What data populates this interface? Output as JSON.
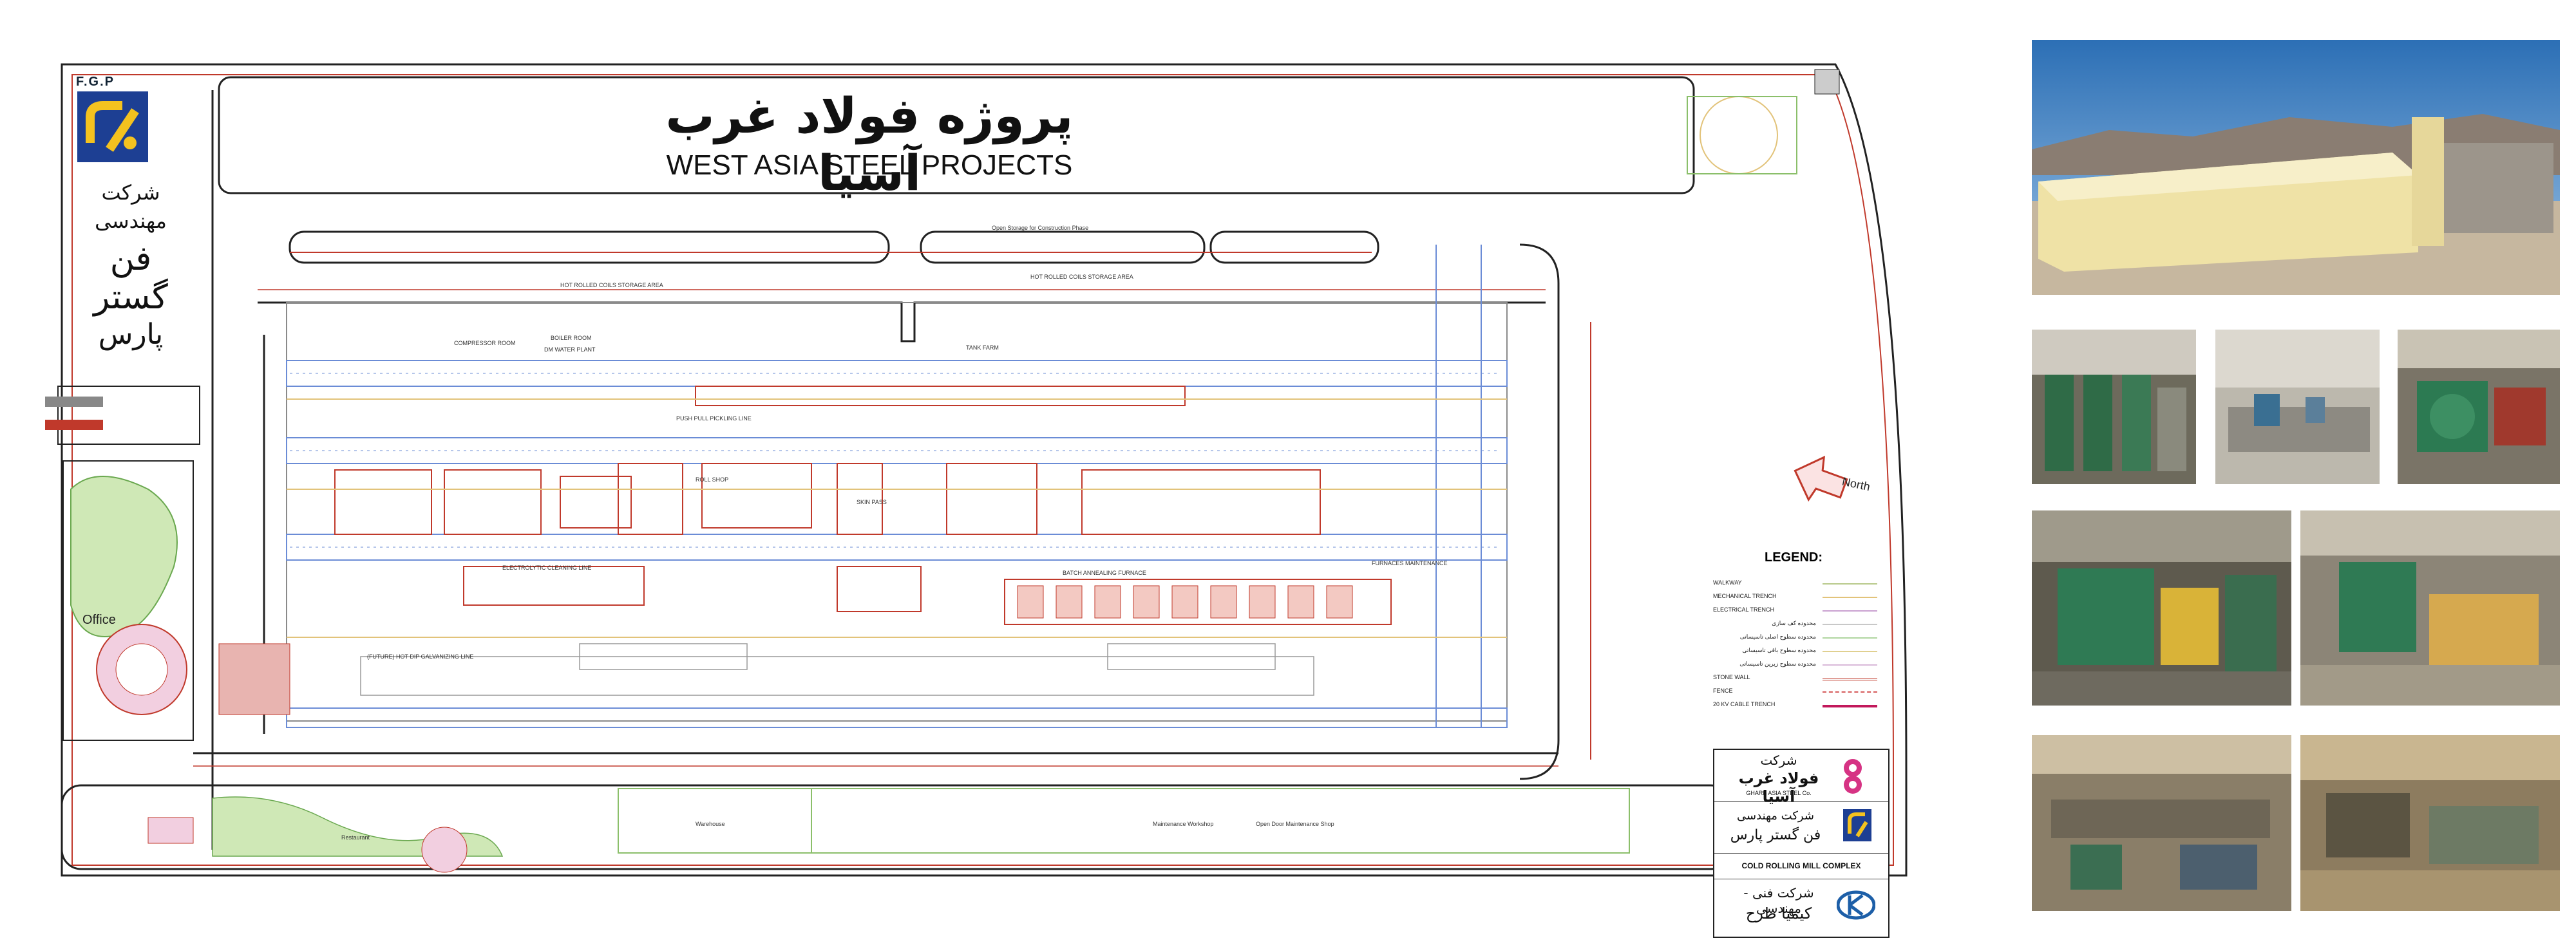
{
  "header": {
    "title_fa": "پروژه فولاد غرب آسیا",
    "title_en": "WEST ASIA STEEL PROJECTS"
  },
  "logo": {
    "abbr": "F.G.P",
    "company_line1": "شرکت",
    "company_line2": "مهندسی",
    "company_line3": "فن گستر",
    "company_line4": "پارس",
    "colors": {
      "brand_blue": "#1d3f93",
      "brand_yellow": "#f4c21f"
    }
  },
  "plan_labels": {
    "open_storage": "Open Storage for Construction Phase",
    "hot_rolled_1": "HOT ROLLED COILS STORAGE AREA",
    "hot_rolled_2": "HOT ROLLED COILS STORAGE AREA",
    "tank_farm": "TANK FARM",
    "push_pull": "PUSH PULL PICKLING LINE",
    "compressor": "COMPRESSOR ROOM",
    "boiler": "BOILER ROOM",
    "dm_water": "DM WATER PLANT",
    "roll_shop": "ROLL SHOP",
    "skin_pass": "SKIN PASS",
    "furnaces": "FURNACES MAINTENANCE",
    "electrolytic": "ELECTROLYTIC CLEANING LINE",
    "hot_dip": "(FUTURE) HOT DIP GALVANIZING LINE",
    "batch_annealing": "BATCH ANNEALING FURNACE",
    "office": "Office",
    "restaurant": "Restaurant",
    "warehouse": "Warehouse",
    "maintenance_workshop": "Maintenance Workshop",
    "open_door_shop": "Open Door Maintenance Shop",
    "north": "North"
  },
  "legend": {
    "title": "LEGEND:",
    "items": [
      {
        "label": "WALKWAY",
        "color": "#b8c98a",
        "style": "solid"
      },
      {
        "label": "MECHANICAL TRENCH",
        "color": "#e2c37a",
        "style": "solid"
      },
      {
        "label": "ELECTRICAL TRENCH",
        "color": "#c9a0d0",
        "style": "solid"
      },
      {
        "label": "محدوده کف سازی",
        "color": "#c8c8c8",
        "style": "solid"
      },
      {
        "label": "محدوده سطوح اصلی تاسیساتی",
        "color": "#b0d6a0",
        "style": "solid"
      },
      {
        "label": "محدوده سطوح باقی تاسیساتی",
        "color": "#e0d090",
        "style": "solid"
      },
      {
        "label": "محدوده سطوح زیرین تاسیساتی",
        "color": "#d9b9d9",
        "style": "solid"
      },
      {
        "label": "STONE WALL",
        "color": "#c0392b",
        "style": "double"
      },
      {
        "label": "FENCE",
        "color": "#d65c5c",
        "style": "dashed"
      },
      {
        "label": "20 KV CABLE TRENCH",
        "color": "#c2185b",
        "style": "thick"
      }
    ]
  },
  "title_block": {
    "client_fa_1": "شرکت",
    "client_fa_2": "فولاد غرب آسیا",
    "client_en": "GHARB ASIA STEEL Co.",
    "consultant_fa_1": "شرکت مهندسی",
    "consultant_fa_2": "فن گستر پارس",
    "drawing_title": "COLD ROLLING MILL COMPLEX",
    "contractor_fa_1": "شرکت فنی - مهندسی",
    "contractor_fa_2": "کیمیا طرح"
  },
  "photos": [
    {
      "name": "exterior-building-photo"
    },
    {
      "name": "interior-photo-1"
    },
    {
      "name": "interior-photo-2"
    },
    {
      "name": "interior-photo-3"
    },
    {
      "name": "interior-photo-4"
    },
    {
      "name": "interior-photo-5"
    },
    {
      "name": "interior-photo-6"
    },
    {
      "name": "interior-photo-7"
    }
  ]
}
